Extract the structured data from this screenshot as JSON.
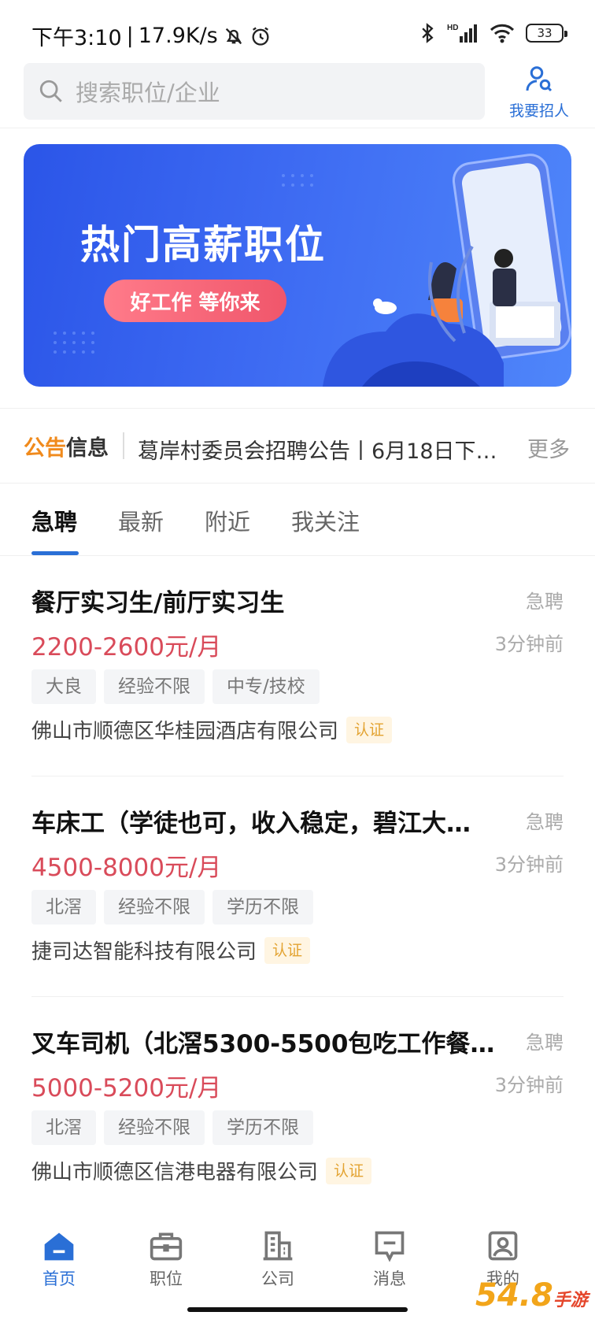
{
  "status_bar": {
    "time": "下午3:10",
    "net_speed": "17.9K/s",
    "battery": "33",
    "signal_label": "HD"
  },
  "header": {
    "search_placeholder": "搜索职位/企业",
    "recruit_label": "我要招人"
  },
  "banner": {
    "title": "热门高薪职位",
    "pill": "好工作 等你来"
  },
  "notice": {
    "tag_part1": "公告",
    "tag_part2": "信息",
    "text": "葛岸村委员会招聘公告丨6月18日下…",
    "more": "更多"
  },
  "tabs": [
    {
      "label": "急聘",
      "active": true
    },
    {
      "label": "最新",
      "active": false
    },
    {
      "label": "附近",
      "active": false
    },
    {
      "label": "我关注",
      "active": false
    }
  ],
  "jobs": [
    {
      "title": "餐厅实习生/前厅实习生",
      "urgent": "急聘",
      "salary": "2200-2600元/月",
      "time": "3分钟前",
      "tags": [
        "大良",
        "经验不限",
        "中专/技校"
      ],
      "company": "佛山市顺德区华桂园酒店有限公司",
      "verified": "认证"
    },
    {
      "title": "车床工（学徒也可，收入稳定，碧江大…",
      "urgent": "急聘",
      "salary": "4500-8000元/月",
      "time": "3分钟前",
      "tags": [
        "北滘",
        "经验不限",
        "学历不限"
      ],
      "company": "捷司达智能科技有限公司",
      "verified": "认证"
    },
    {
      "title": "叉车司机（北滘5300-5500包吃工作餐…",
      "urgent": "急聘",
      "salary": "5000-5200元/月",
      "time": "3分钟前",
      "tags": [
        "北滘",
        "经验不限",
        "学历不限"
      ],
      "company": "佛山市顺德区信港电器有限公司",
      "verified": "认证"
    }
  ],
  "bottom_nav": [
    {
      "label": "首页",
      "icon": "home-icon",
      "active": true
    },
    {
      "label": "职位",
      "icon": "briefcase-icon",
      "active": false
    },
    {
      "label": "公司",
      "icon": "building-icon",
      "active": false
    },
    {
      "label": "消息",
      "icon": "message-icon",
      "active": false
    },
    {
      "label": "我的",
      "icon": "profile-icon",
      "active": false
    }
  ],
  "watermark": {
    "main": "54.8",
    "sub": "手游网"
  },
  "colors": {
    "accent": "#2a6fd6",
    "salary": "#d94b5a",
    "notice_orange": "#f08a1c"
  }
}
